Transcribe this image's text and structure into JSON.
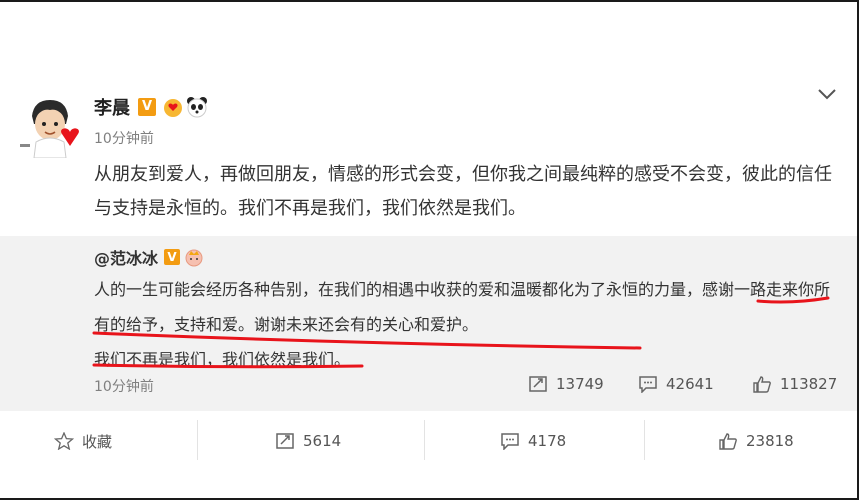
{
  "post": {
    "author": "李晨",
    "time": "10分钟前",
    "text": "从朋友到爱人，再做回朋友，情感的形式会变，但你我之间最纯粹的感受不会变，彼此的信任与支持是永恒的。我们不再是我们，我们依然是我们。"
  },
  "badges": {
    "v": "V"
  },
  "repost": {
    "author": "@范冰冰",
    "text": "人的一生可能会经历各种告别，在我们的相遇中收获的爱和温暖都化为了永恒的力量，感谢一路走来你所有的给予，支持和爱。谢谢未来还会有的关心和爱护。",
    "text2": "我们不再是我们，我们依然是我们。",
    "time": "10分钟前",
    "stats": {
      "reposts": "13749",
      "comments": "42641",
      "likes": "113827"
    }
  },
  "actions": {
    "favorite": "收藏",
    "reposts": "5614",
    "comments": "4178",
    "likes": "23818"
  },
  "colors": {
    "underline": "#e8141b",
    "verified": "#f39c12",
    "repost_bg": "#f2f2f2"
  },
  "icons": [
    "avatar",
    "verified-v-icon",
    "hand-heart-icon",
    "panda-icon",
    "chevron-down-icon",
    "repost-icon",
    "comment-icon",
    "like-icon",
    "star-icon"
  ]
}
